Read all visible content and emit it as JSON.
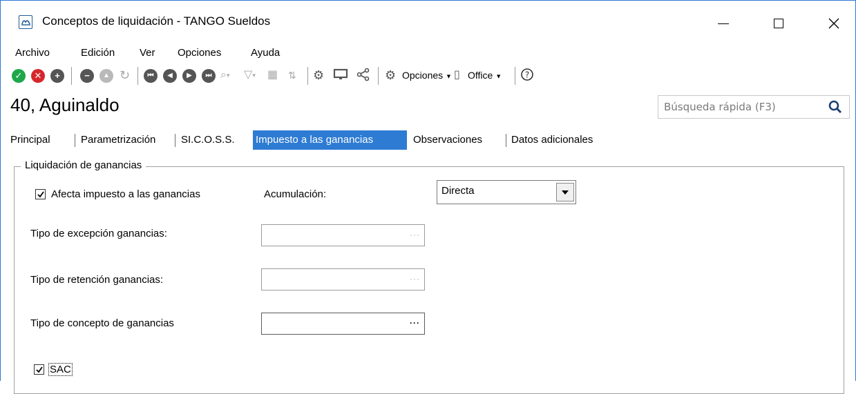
{
  "window": {
    "title": "Conceptos de liquidación - TANGO Sueldos",
    "app_icon_text": "ꟷ"
  },
  "menu": {
    "items": [
      "Archivo",
      "Edición",
      "Ver",
      "Opciones",
      "Ayuda"
    ]
  },
  "toolbar": {
    "opciones_label": "Opciones",
    "office_label": "Office"
  },
  "record": {
    "title": "40, Aguinaldo"
  },
  "search": {
    "placeholder": "Búsqueda rápida (F3)"
  },
  "tabs": [
    {
      "label": "Principal",
      "active": false
    },
    {
      "label": "Parametrización",
      "active": false
    },
    {
      "label": "SI.C.O.S.S.",
      "active": false
    },
    {
      "label": "Impuesto a las ganancias",
      "active": true
    },
    {
      "label": "Observaciones",
      "active": false
    },
    {
      "label": "Datos adicionales",
      "active": false
    }
  ],
  "group": {
    "legend": "Liquidación de ganancias",
    "afecta_label": "Afecta impuesto a las ganancias",
    "afecta_checked": true,
    "acumulacion_label": "Acumulación:",
    "acumulacion_value": "Directa",
    "excepcion_label": "Tipo de excepción ganancias:",
    "excepcion_value": "",
    "retencion_label": "Tipo de retención ganancias:",
    "retencion_value": "",
    "concepto_label": "Tipo de concepto de ganancias",
    "concepto_value": "",
    "sac_label": "SAC",
    "sac_checked": true
  },
  "colors": {
    "accent": "#2e7bd3",
    "ok": "#1ea84b",
    "cancel": "#d6262b"
  }
}
